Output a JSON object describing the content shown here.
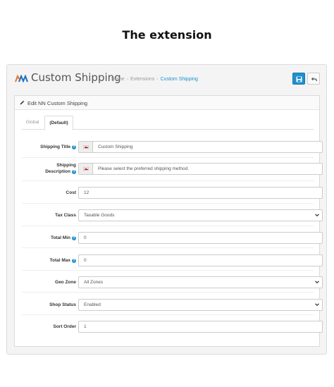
{
  "page_heading": "The extension",
  "header": {
    "title": "Custom Shipping",
    "breadcrumb": [
      "Home",
      "Extensions",
      "Custom Shipping"
    ],
    "save_icon": "save-icon",
    "back_icon": "reply-icon"
  },
  "panel": {
    "title": "Edit NN Custom Shipping",
    "tabs": [
      "Global",
      "(Default)"
    ],
    "active_tab": "(Default)"
  },
  "form": {
    "shipping_title": {
      "label": "Shipping Title",
      "value": "Custom Shipping"
    },
    "shipping_description": {
      "label_line1": "Shipping",
      "label_line2": "Description",
      "value": "Please select the preferred shipping method."
    },
    "cost": {
      "label": "Cost",
      "value": "12"
    },
    "tax_class": {
      "label": "Tax Class",
      "value": "Taxable Goods"
    },
    "total_min": {
      "label": "Total Min",
      "value": "0"
    },
    "total_max": {
      "label": "Total Max",
      "value": "0"
    },
    "geo_zone": {
      "label": "Geo Zone",
      "value": "All Zones"
    },
    "shop_status": {
      "label": "Shop Status",
      "value": "Enabled"
    },
    "sort_order": {
      "label": "Sort Order",
      "value": "1"
    }
  },
  "colors": {
    "primary": "#1e91cf",
    "panel_bg": "#f4f4f4",
    "flag_red": "#cc2a2a"
  }
}
